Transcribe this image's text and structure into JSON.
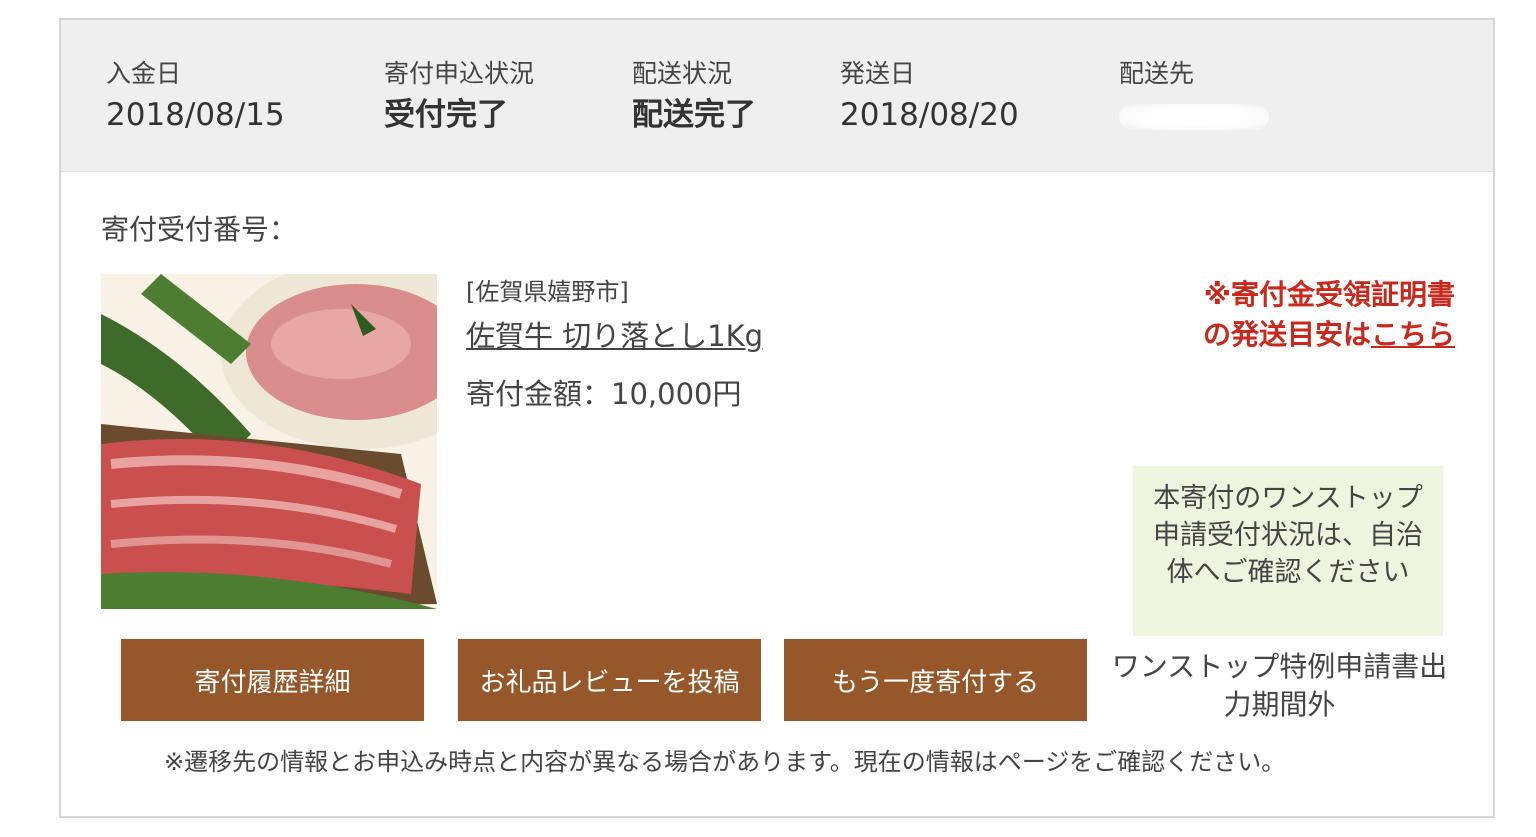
{
  "summary": {
    "payment_date_label": "入金日",
    "payment_date": "2018/08/15",
    "application_status_label": "寄付申込状況",
    "application_status": "受付完了",
    "delivery_status_label": "配送状況",
    "delivery_status": "配送完了",
    "ship_date_label": "発送日",
    "ship_date": "2018/08/20",
    "destination_label": "配送先"
  },
  "receipt_number_label": "寄付受付番号：",
  "product": {
    "municipality": "[佐賀県嬉野市]",
    "name": "佐賀牛 切り落とし1Kg",
    "amount": "寄付金額：10,000円"
  },
  "notice": {
    "line1": "※寄付金受領証明書",
    "line2_prefix": "の発送目安は",
    "link": "こちら"
  },
  "onestop_status": "本寄付のワンストップ申請受付状況は、自治体へご確認ください",
  "buttons": {
    "history_detail": "寄付履歴詳細",
    "post_review": "お礼品レビューを投稿",
    "donate_again": "もう一度寄付する"
  },
  "onestop_out_of_period": "ワンストップ特例申請書出力期間外",
  "footnote": "※遷移先の情報とお申込み時点と内容が異なる場合があります。現在の情報はページをご確認ください。",
  "colors": {
    "button": "#96582a",
    "notice": "#c9281b",
    "onestop_bg": "#eef5de",
    "summary_bg": "#efefef"
  }
}
